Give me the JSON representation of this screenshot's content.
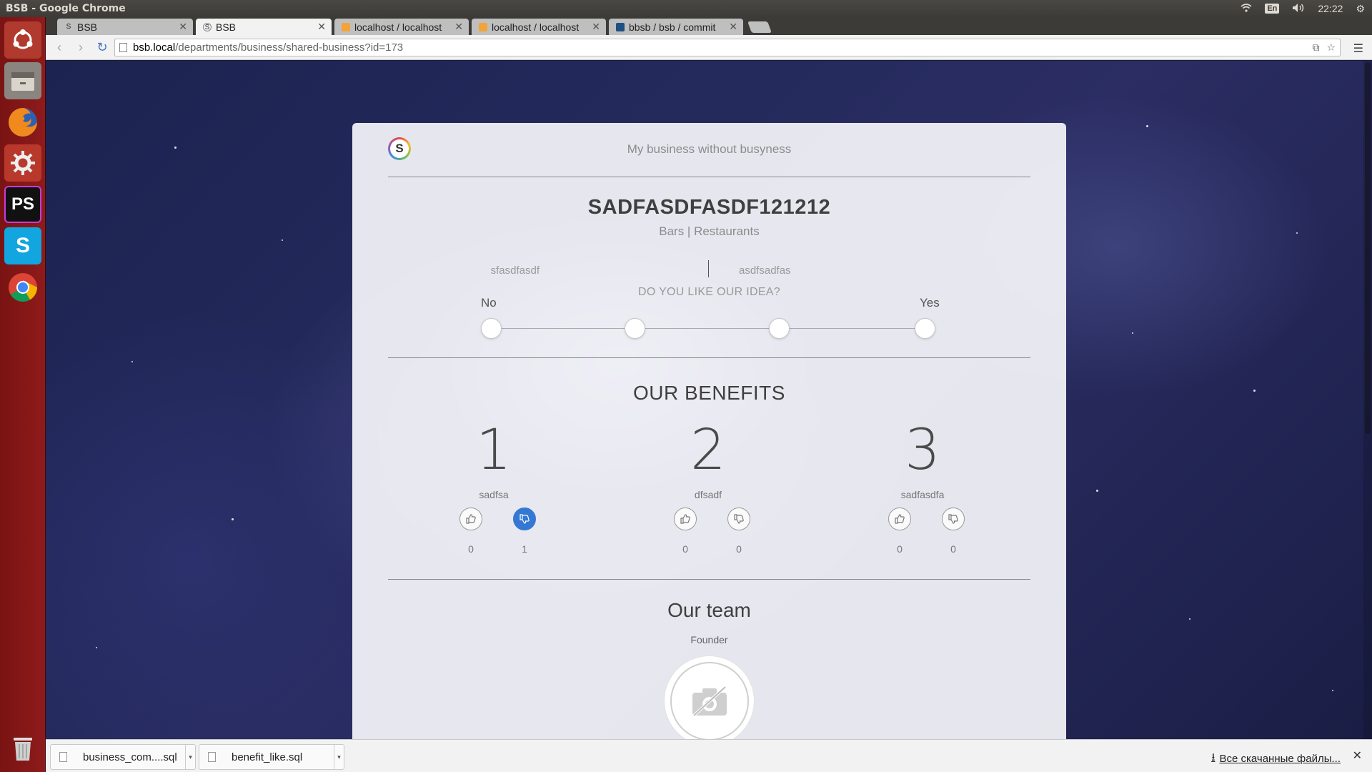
{
  "window": {
    "title": "BSB - Google Chrome"
  },
  "system_tray": {
    "language": "En",
    "time": "22:22"
  },
  "tabs": [
    {
      "label": "BSB",
      "favicon": "S",
      "active": false
    },
    {
      "label": "BSB",
      "favicon": "S",
      "active": true
    },
    {
      "label": "localhost / localhost",
      "favicon": "pma",
      "active": false
    },
    {
      "label": "localhost / localhost",
      "favicon": "pma",
      "active": false
    },
    {
      "label": "bbsb / bsb / commit",
      "favicon": "bb",
      "active": false
    }
  ],
  "address_bar": {
    "host": "bsb.local",
    "path": "/departments/business/shared-business?id=173"
  },
  "launcher": [
    {
      "icon": "ubuntu-dash-icon"
    },
    {
      "icon": "files-icon"
    },
    {
      "icon": "firefox-icon"
    },
    {
      "icon": "settings-icon"
    },
    {
      "icon": "phpstorm-icon",
      "text": "PS"
    },
    {
      "icon": "skype-icon",
      "text": "S"
    },
    {
      "icon": "chrome-icon"
    },
    {
      "icon": "trash-icon"
    }
  ],
  "page": {
    "logo_letter": "S",
    "tagline": "My business without busyness",
    "business_name": "SADFASDFASDF121212",
    "category": "Bars | Restaurants",
    "left_info": "sfasdfasdf",
    "right_info": "asdfsadfas",
    "question": "DO YOU LIKE OUR IDEA?",
    "scale_no": "No",
    "scale_yes": "Yes",
    "benefits_title": "OUR BENEFITS",
    "benefits": [
      {
        "number": "1",
        "name": "sadfsa",
        "likes": "0",
        "dislikes": "1",
        "disliked": true
      },
      {
        "number": "2",
        "name": "dfsadf",
        "likes": "0",
        "dislikes": "0",
        "disliked": false
      },
      {
        "number": "3",
        "name": "sadfasdfa",
        "likes": "0",
        "dislikes": "0",
        "disliked": false
      }
    ],
    "team_title": "Our team",
    "founder_label": "Founder"
  },
  "downloads": {
    "items": [
      "business_com....sql",
      "benefit_like.sql"
    ],
    "show_all": "Все скачанные файлы..."
  },
  "colors": {
    "accent": "#3478d4",
    "launcher": "#8e1b1b"
  }
}
